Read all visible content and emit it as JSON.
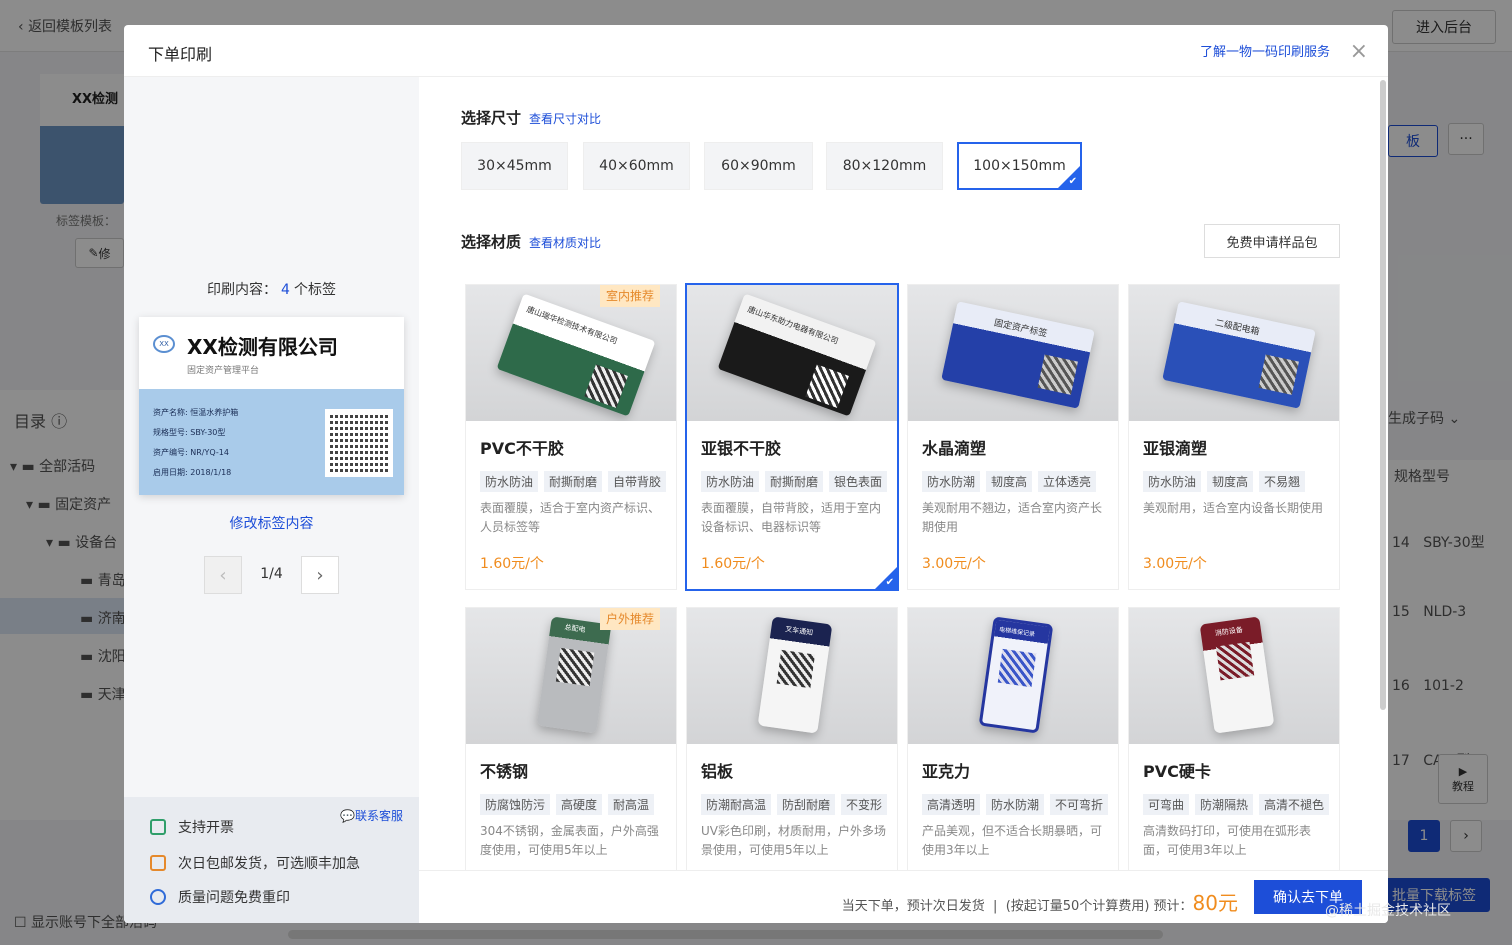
{
  "background": {
    "back_label": "返回模板列表",
    "admin_button": "进入后台",
    "template_title": "XX检测",
    "template_label": "标签模板：",
    "edit_short": "修",
    "dir_title": "目录",
    "tree": [
      "全部活码",
      "固定资产",
      "设备台",
      "青岛",
      "济南",
      "沈阳",
      "天津"
    ],
    "gen_code": "生成子码",
    "col_spec": "规格型号",
    "rows": [
      {
        "id": "14",
        "spec": "SBY-30型"
      },
      {
        "id": "15",
        "spec": "NLD-3"
      },
      {
        "id": "16",
        "spec": "101-2"
      },
      {
        "id": "17",
        "spec": "CA-2型"
      }
    ],
    "page_current": "1",
    "batch_download": "批量下载标签",
    "tutorial": "教程",
    "show_accounts": "显示账号下全部活码",
    "more": "···",
    "board_label": "板"
  },
  "modal": {
    "title": "下单印刷",
    "top_link": "了解一物一码印刷服务",
    "close": "×",
    "print_content_label": "印刷内容：",
    "print_count": "4",
    "print_unit": "个标签",
    "edit_link": "修改标签内容",
    "page_indicator": "1/4",
    "card": {
      "logo": "XX",
      "company": "XX检测有限公司",
      "subtitle": "固定资产管理平台",
      "rows": [
        "资产名称: 恒温水养护箱",
        "规格型号: SBY-30型",
        "资产编号: NR/YQ-14",
        "启用日期: 2018/1/18"
      ]
    },
    "service_link": "联系客服",
    "features": [
      "支持开票",
      "次日包邮发货，可选顺丰加急",
      "质量问题免费重印"
    ],
    "size_section": "选择尺寸",
    "size_compare": "查看尺寸对比",
    "sizes": [
      "30×45mm",
      "40×60mm",
      "60×90mm",
      "80×120mm",
      "100×150mm"
    ],
    "material_section": "选择材质",
    "material_compare": "查看材质对比",
    "sample_button": "免费申请样品包",
    "materials": [
      {
        "name": "PVC不干胶",
        "badge": "室内推荐",
        "tags": [
          "防水防油",
          "耐撕耐磨",
          "自带背胶"
        ],
        "desc": "表面覆膜，适合于室内资产标识、人员标签等",
        "price": "1.60元/个",
        "color": "#2e6a4a",
        "top": "#ffffff",
        "text": "唐山瑞华检测技术有限公司"
      },
      {
        "name": "亚银不干胶",
        "badge": "",
        "tags": [
          "防水防油",
          "耐撕耐磨",
          "银色表面"
        ],
        "desc": "表面覆膜，自带背胶，适用于室内设备标识、电器标识等",
        "price": "1.60元/个",
        "color": "#1a1a1a",
        "top": "#f2f2f2",
        "text": "唐山华东助力电器有限公司"
      },
      {
        "name": "水晶滴塑",
        "badge": "",
        "tags": [
          "防水防潮",
          "韧度高",
          "立体透亮"
        ],
        "desc": "美观耐用不翘边，适合室内资产长期使用",
        "price": "3.00元/个",
        "color": "#2440a8",
        "top": "#e8ecf7",
        "text": "固定资产标签"
      },
      {
        "name": "亚银滴塑",
        "badge": "",
        "tags": [
          "防水防油",
          "韧度高",
          "不易翘"
        ],
        "desc": "美观耐用，适合室内设备长期使用",
        "price": "3.00元/个",
        "color": "#2a50b8",
        "top": "#e8ecf7",
        "text": "二级配电箱"
      },
      {
        "name": "不锈钢",
        "badge": "户外推荐",
        "tags": [
          "防腐蚀防污",
          "高硬度",
          "耐高温"
        ],
        "desc": "304不锈钢，金属表面，户外高强度使用，可使用5年以上",
        "price": "",
        "color": "#b9bbbe",
        "top": "#3d6b4f",
        "text": "总配电"
      },
      {
        "name": "铝板",
        "badge": "",
        "tags": [
          "防潮耐高温",
          "防刮耐磨",
          "不变形"
        ],
        "desc": "UV彩色印刷，材质耐用，户外多场景使用，可使用5年以上",
        "price": "",
        "color": "#f5f5f5",
        "top": "#1b2350",
        "text": "叉车通知"
      },
      {
        "name": "亚克力",
        "badge": "",
        "tags": [
          "高清透明",
          "防水防潮",
          "不可弯折"
        ],
        "desc": "产品美观，但不适合长期暴晒，可使用3年以上",
        "price": "",
        "color": "#f0f2fa",
        "top": "#2536a0",
        "text": "电梯维保记录"
      },
      {
        "name": "PVC硬卡",
        "badge": "",
        "tags": [
          "可弯曲",
          "防潮隔热",
          "高清不褪色"
        ],
        "desc": "高清数码打印，可使用在弧形表面，可使用3年以上",
        "price": "",
        "color": "#f5f5f5",
        "top": "#7a1c28",
        "text": "消防设备"
      }
    ],
    "bottom_note": "当天下单，预计次日发货",
    "bottom_calc": "(按起订量50个计算费用) 预计：",
    "bottom_price": "80元",
    "confirm_button": "确认去下单"
  },
  "watermark": "@稀土掘金技术社区"
}
